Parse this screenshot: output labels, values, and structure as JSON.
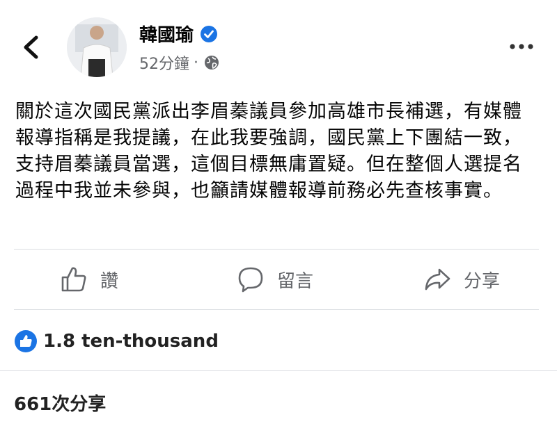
{
  "header": {
    "author_name": "韓國瑜",
    "timestamp": "52分鐘",
    "separator": "·",
    "icons": {
      "back": "chevron-left-icon",
      "verified": "verified-badge-icon",
      "privacy": "globe-icon",
      "more": "more-options-icon"
    },
    "colors": {
      "verified": "#1b74e4"
    }
  },
  "post": {
    "text": "關於這次國民黨派出李眉蓁議員參加高雄市長補選，有媒體報導指稱是我提議，在此我要強調，國民黨上下團結一致，支持眉蓁議員當選，這個目標無庸置疑。但在整個人選提名過程中我並未參與，也籲請媒體報導前務必先查核事實。"
  },
  "actions": [
    {
      "label": "讚",
      "icon": "thumbs-up-icon"
    },
    {
      "label": "留言",
      "icon": "comment-icon"
    },
    {
      "label": "分享",
      "icon": "share-icon"
    }
  ],
  "reactions": {
    "count_text": "1.8 ten-thousand",
    "icon": "like-reaction-icon",
    "color": "#1b74e4"
  },
  "shares": {
    "text": "661次分享"
  }
}
